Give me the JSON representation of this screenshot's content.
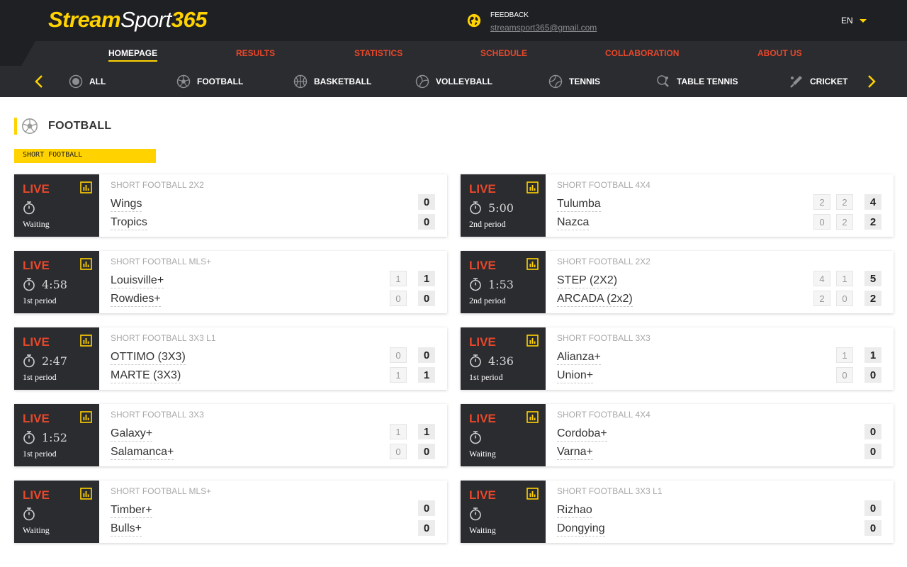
{
  "brand": {
    "part1": "Stream",
    "part2": "Sport",
    "part3": "365"
  },
  "feedback": {
    "title": "FEEDBACK",
    "email": "streamsport365@gmail.com"
  },
  "language": "EN",
  "nav": [
    "HOMEPAGE",
    "RESULTS",
    "STATISTICS",
    "SCHEDULE",
    "COLLABORATION",
    "ABOUT US"
  ],
  "sports": [
    "ALL",
    "FOOTBALL",
    "BASKETBALL",
    "VOLLEYBALL",
    "TENNIS",
    "TABLE TENNIS",
    "CRICKET"
  ],
  "section": {
    "title": "FOOTBALL",
    "sublabel": "SHORT FOOTBALL"
  },
  "colors": {
    "accent": "#ffd200",
    "live": "#e8472a",
    "dark": "#2b2c30",
    "header": "#1f2023"
  },
  "matches": [
    {
      "live": "LIVE",
      "time": "",
      "status": "Waiting",
      "league": "SHORT FOOTBALL 2X2",
      "team1": "Wings",
      "team2": "Tropics",
      "score1": "0",
      "score2": "0",
      "periods1": [],
      "periods2": []
    },
    {
      "live": "LIVE",
      "time": "5:00",
      "status": "2nd period",
      "league": "SHORT FOOTBALL 4X4",
      "team1": "Tulumba",
      "team2": "Nazca",
      "score1": "4",
      "score2": "2",
      "periods1": [
        "2",
        "2"
      ],
      "periods2": [
        "0",
        "2"
      ]
    },
    {
      "live": "LIVE",
      "time": "4:58",
      "status": "1st period",
      "league": "SHORT FOOTBALL MLS+",
      "team1": "Louisville+",
      "team2": "Rowdies+",
      "score1": "1",
      "score2": "0",
      "periods1": [
        "1"
      ],
      "periods2": [
        "0"
      ]
    },
    {
      "live": "LIVE",
      "time": "1:53",
      "status": "2nd period",
      "league": "SHORT FOOTBALL 2X2",
      "team1": "STEP (2X2)",
      "team2": "ARCADA (2x2)",
      "score1": "5",
      "score2": "2",
      "periods1": [
        "4",
        "1"
      ],
      "periods2": [
        "2",
        "0"
      ]
    },
    {
      "live": "LIVE",
      "time": "2:47",
      "status": "1st period",
      "league": "SHORT FOOTBALL 3X3 L1",
      "team1": "OTTIMO (3X3)",
      "team2": "MARTE (3X3)",
      "score1": "0",
      "score2": "1",
      "periods1": [
        "0"
      ],
      "periods2": [
        "1"
      ]
    },
    {
      "live": "LIVE",
      "time": "4:36",
      "status": "1st period",
      "league": "SHORT FOOTBALL 3X3",
      "team1": "Alianza+",
      "team2": "Union+",
      "score1": "1",
      "score2": "0",
      "periods1": [
        "1"
      ],
      "periods2": [
        "0"
      ]
    },
    {
      "live": "LIVE",
      "time": "1:52",
      "status": "1st period",
      "league": "SHORT FOOTBALL 3X3",
      "team1": "Galaxy+",
      "team2": "Salamanca+",
      "score1": "1",
      "score2": "0",
      "periods1": [
        "1"
      ],
      "periods2": [
        "0"
      ]
    },
    {
      "live": "LIVE",
      "time": "",
      "status": "Waiting",
      "league": "SHORT FOOTBALL 4X4",
      "team1": "Cordoba+",
      "team2": "Varna+",
      "score1": "0",
      "score2": "0",
      "periods1": [],
      "periods2": []
    },
    {
      "live": "LIVE",
      "time": "",
      "status": "Waiting",
      "league": "SHORT FOOTBALL MLS+",
      "team1": "Timber+",
      "team2": "Bulls+",
      "score1": "0",
      "score2": "0",
      "periods1": [],
      "periods2": []
    },
    {
      "live": "LIVE",
      "time": "",
      "status": "Waiting",
      "league": "SHORT FOOTBALL 3X3 L1",
      "team1": "Rizhao",
      "team2": "Dongying",
      "score1": "0",
      "score2": "0",
      "periods1": [],
      "periods2": []
    }
  ]
}
